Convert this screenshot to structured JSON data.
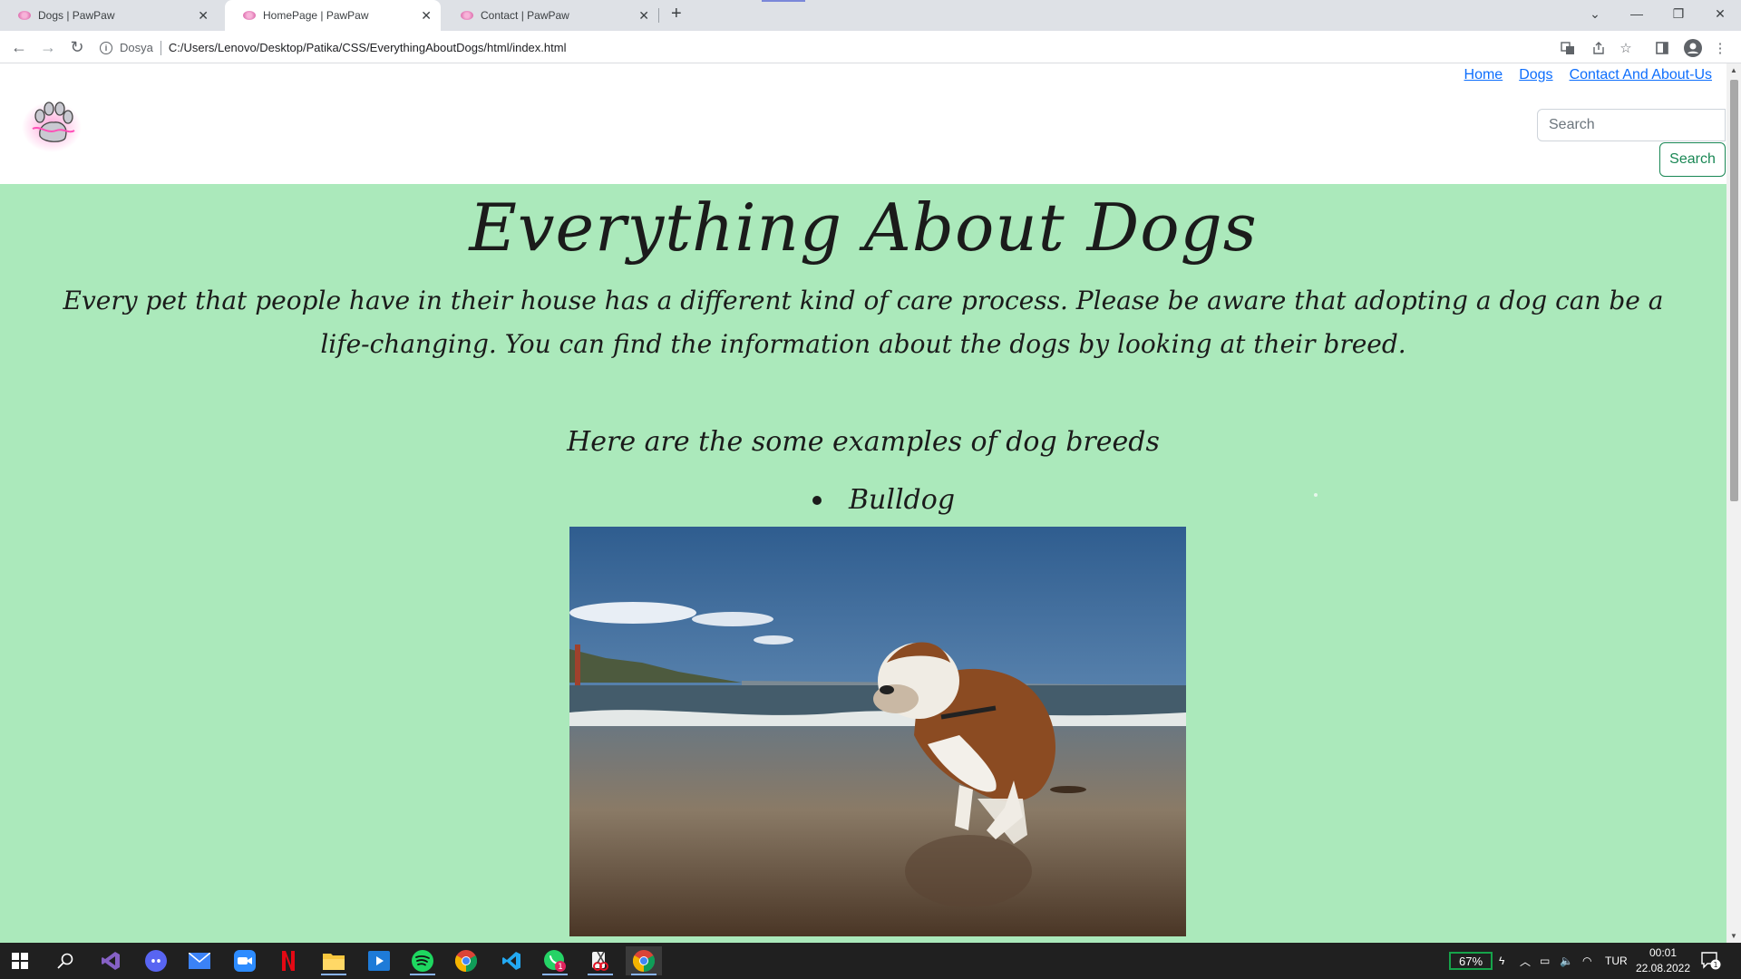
{
  "browser": {
    "tabs": [
      {
        "title": "Dogs | PawPaw",
        "active": false
      },
      {
        "title": "HomePage | PawPaw",
        "active": true
      },
      {
        "title": "Contact | PawPaw",
        "active": false
      }
    ],
    "address_scheme": "Dosya",
    "address_url": "C:/Users/Lenovo/Desktop/Patika/CSS/EverythingAboutDogs/html/index.html",
    "icons": [
      "back-icon",
      "forward-icon",
      "reload-icon",
      "info-icon",
      "translate-icon",
      "share-icon",
      "star-icon",
      "side-panel-icon",
      "profile-icon",
      "menu-icon"
    ]
  },
  "site": {
    "nav": {
      "home": "Home ",
      "dogs": "Dogs",
      "contact": "Contact And About-Us "
    },
    "search": {
      "placeholder": "Search",
      "button": "Search"
    },
    "title": "Everything About Dogs",
    "intro": "Every pet that people have in their house has a different kind of care process. Please be aware that adopting a dog can be a life-changing. You can find the information about the dogs by looking at their breed.",
    "subtitle": "Here are the some examples of dog breeds",
    "breeds": [
      "Bulldog"
    ],
    "colors": {
      "main_bg": "#abe9bb",
      "link": "#0d6efd",
      "search_button": "#198754"
    }
  },
  "taskbar": {
    "battery": "67%",
    "language": "TUR",
    "time": "00:01",
    "date": "22.08.2022",
    "notification_count": "1",
    "whatsapp_badge": "1"
  }
}
